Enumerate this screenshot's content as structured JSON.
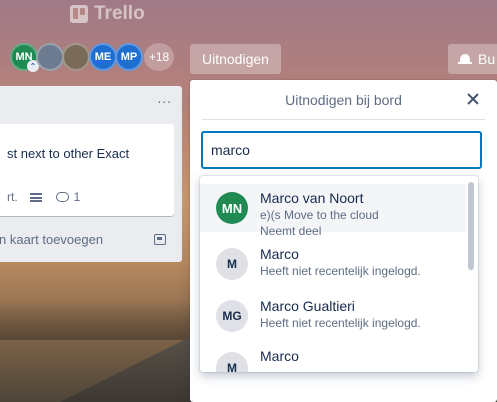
{
  "app": {
    "name": "Trello"
  },
  "board_header": {
    "members": [
      {
        "initials": "MN",
        "badge_icon": "admin-chevron-icon"
      },
      {
        "initials": "",
        "avatar": "photo-avatar"
      },
      {
        "initials": "",
        "avatar": "photo-avatar"
      },
      {
        "initials": "ME"
      },
      {
        "initials": "MP"
      }
    ],
    "more_members": "+18",
    "invite_label": "Uitnodigen",
    "butler_label": "Bu",
    "butler_icon": "bell-icon"
  },
  "list": {
    "menu_label": "...",
    "card": {
      "title": "st next to other Exact",
      "due": "rt.",
      "comments": "1"
    },
    "add_card_label": "n kaart toevoegen"
  },
  "invite_popover": {
    "title": "Uitnodigen bij bord",
    "search_value": "marco",
    "results": [
      {
        "initials": "MN",
        "name": "Marco van Noort",
        "line1": "e)(s Move to the cloud",
        "line2": "Neemt deel",
        "color": "#1f8a51"
      },
      {
        "initials": "M",
        "name": "Marco",
        "line1": "Heeft niet recentelijk ingelogd.",
        "line2": ""
      },
      {
        "initials": "MG",
        "name": "Marco Gualtieri",
        "line1": "Heeft niet recentelijk ingelogd.",
        "line2": ""
      },
      {
        "initials": "M",
        "name": "Marco",
        "line1": "",
        "line2": ""
      }
    ]
  },
  "colors": {
    "accent": "#0079bf",
    "member_green": "#1f8a51",
    "member_blue": "#1f6fd1"
  }
}
